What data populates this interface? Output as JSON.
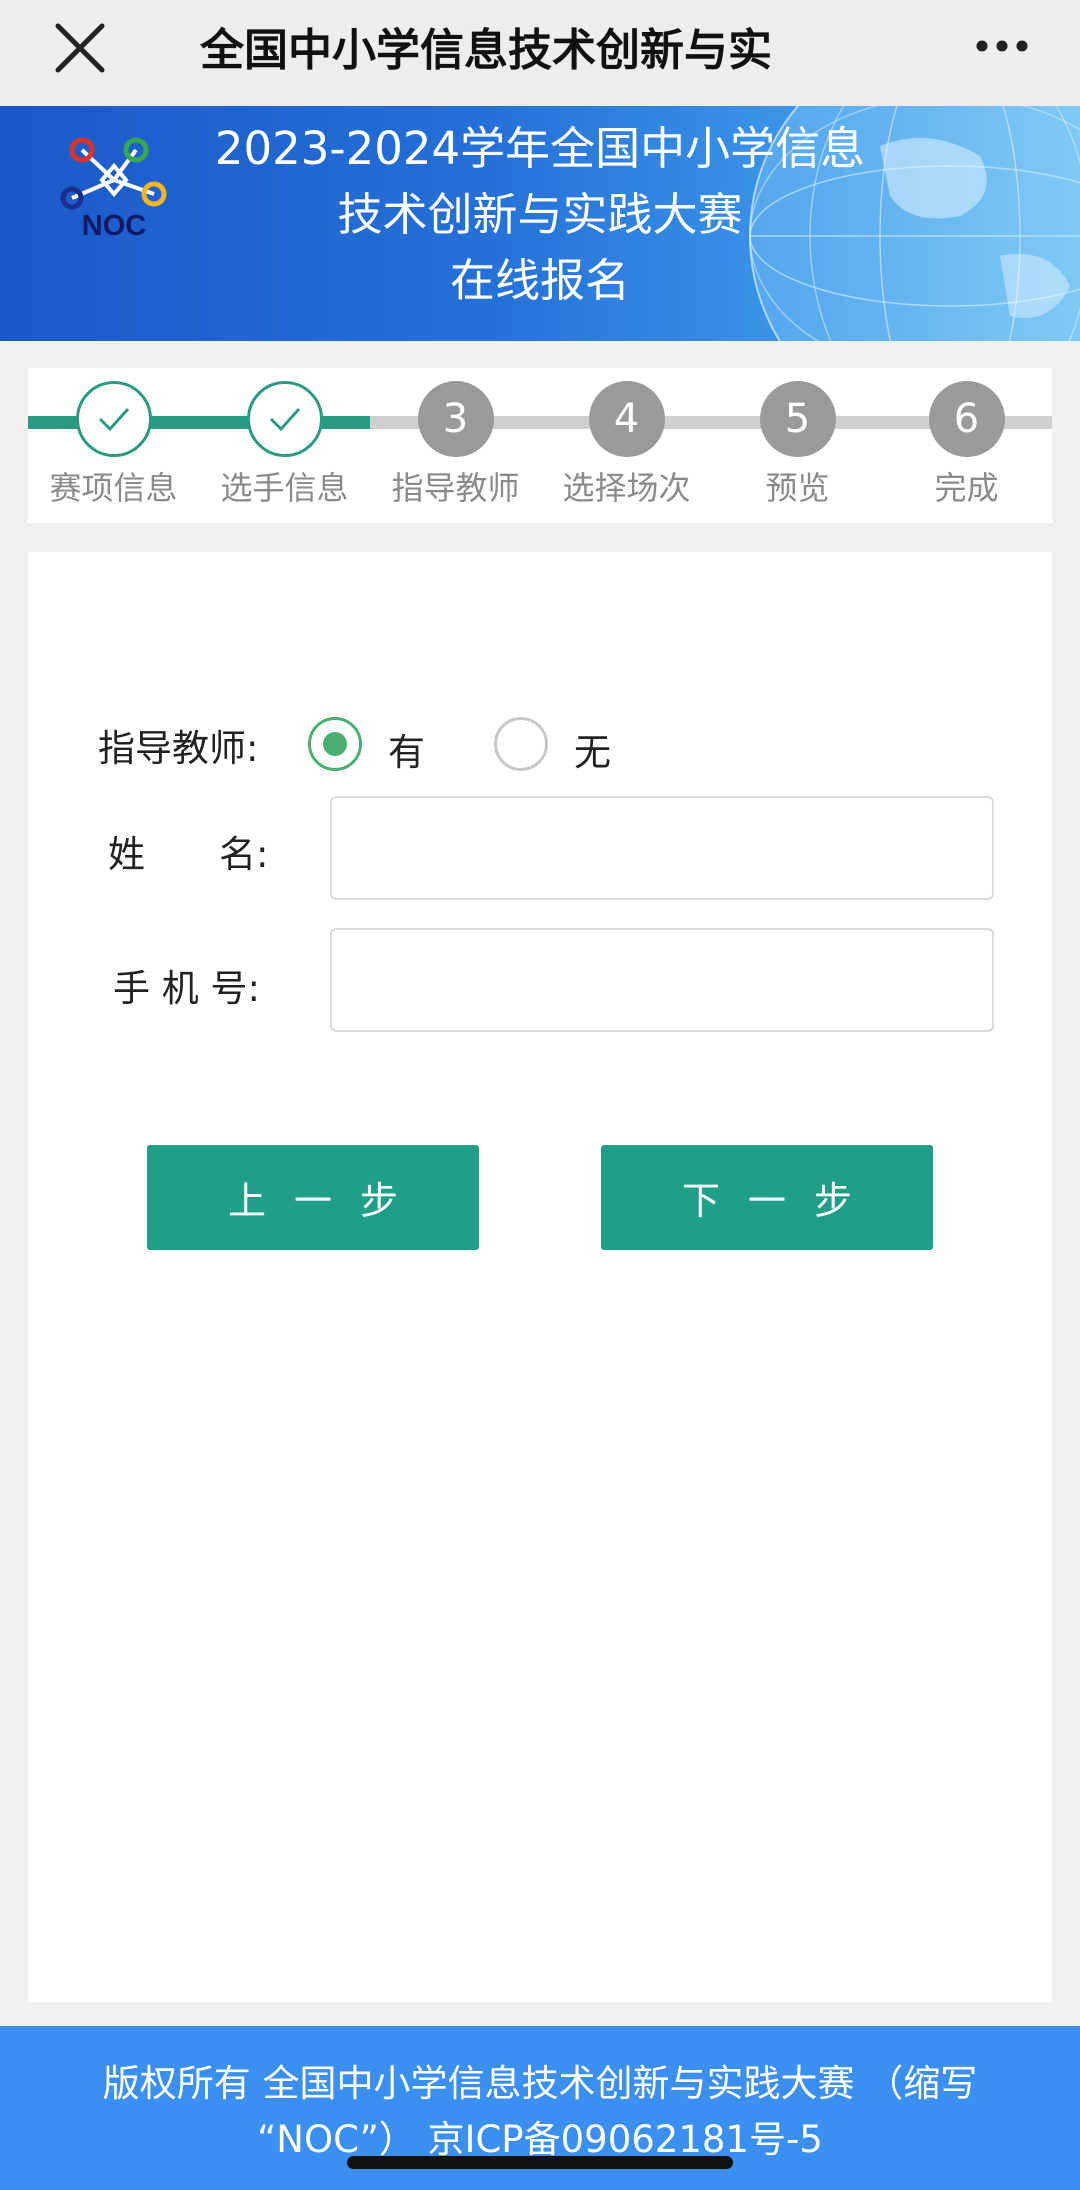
{
  "navbar": {
    "title": "全国中小学信息技术创新与实",
    "close_icon": "close-icon",
    "more_icon": "more-horizontal-icon"
  },
  "banner": {
    "logo_text": "NOC",
    "title_lines": [
      "2023-2024学年全国中小学信息",
      "技术创新与实践大赛",
      "在线报名"
    ]
  },
  "steps": [
    {
      "number": "1",
      "label": "赛项信息",
      "done": true
    },
    {
      "number": "2",
      "label": "选手信息",
      "done": true
    },
    {
      "number": "3",
      "label": "指导教师",
      "done": false
    },
    {
      "number": "4",
      "label": "选择场次",
      "done": false
    },
    {
      "number": "5",
      "label": "预览",
      "done": false
    },
    {
      "number": "6",
      "label": "完成",
      "done": false
    }
  ],
  "form": {
    "teacher_label": "指导教师:",
    "option_yes": "有",
    "option_no": "无",
    "selected": "有",
    "name_label": "姓　　名:",
    "name_value": "",
    "phone_label": "手 机 号:",
    "phone_value": ""
  },
  "buttons": {
    "prev": "上一步",
    "next": "下一步"
  },
  "footer": {
    "line1": "版权所有 全国中小学信息技术创新与实践大赛 （缩写",
    "line2": "“NOC”） 京ICP备09062181号-5"
  },
  "colors": {
    "primary": "#1f9e88",
    "step_done": "#2a9a85",
    "step_todo": "#9a9a9a",
    "radio_active": "#4caf72",
    "footer": "#3a8ff0",
    "banner": "#2570d8"
  }
}
